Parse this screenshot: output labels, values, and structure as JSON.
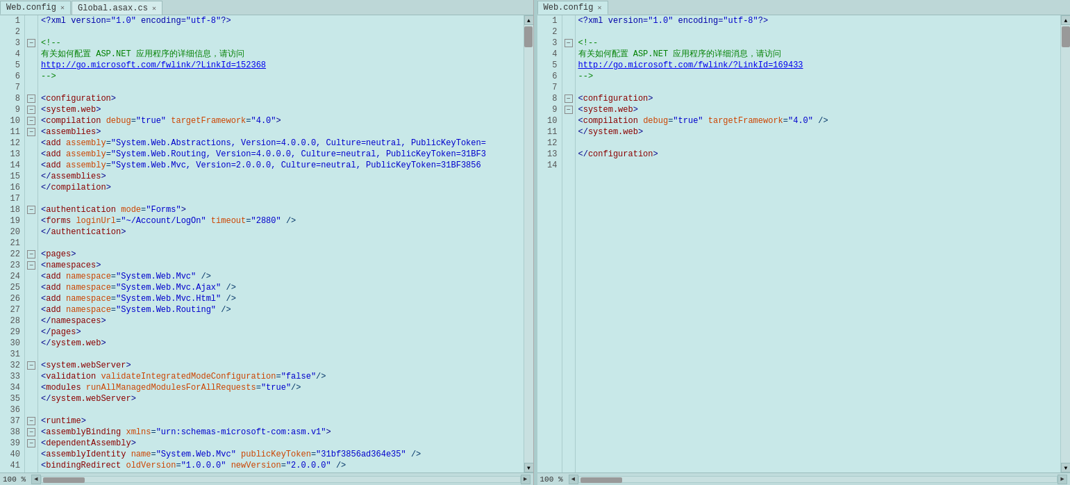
{
  "panes": [
    {
      "id": "left",
      "tabs": [
        {
          "label": "Web.config",
          "active": true,
          "closable": true
        },
        {
          "label": "Global.asax.cs",
          "active": false,
          "closable": true
        }
      ],
      "lines": [
        {
          "num": 1,
          "indent": 0,
          "collapse": null,
          "html": "<span class='xml-pi'>&lt;?xml version=<span class='xml-value'>\"1.0\"</span> encoding=<span class='xml-value'>\"utf-8\"</span>?&gt;</span>"
        },
        {
          "num": 2,
          "indent": 0,
          "collapse": null,
          "html": ""
        },
        {
          "num": 3,
          "indent": 0,
          "collapse": "minus",
          "html": "<span class='xml-comment'>&lt;!--</span>"
        },
        {
          "num": 4,
          "indent": 1,
          "collapse": null,
          "html": "<span class='xml-comment'>  有关如何配置 ASP.NET 应用程序的详细信息，请访问</span>"
        },
        {
          "num": 5,
          "indent": 1,
          "collapse": null,
          "html": "<span class='xml-link'>  http://go.microsoft.com/fwlink/?LinkId=152368</span>"
        },
        {
          "num": 6,
          "indent": 1,
          "collapse": null,
          "html": "<span class='xml-comment'>  --&gt;</span>"
        },
        {
          "num": 7,
          "indent": 0,
          "collapse": null,
          "html": ""
        },
        {
          "num": 8,
          "indent": 0,
          "collapse": "minus",
          "html": "<span class='xml-bracket'>&lt;</span><span class='xml-tag'>configuration</span><span class='xml-bracket'>&gt;</span>"
        },
        {
          "num": 9,
          "indent": 1,
          "collapse": "minus",
          "html": "  <span class='xml-bracket'>&lt;</span><span class='xml-tag'>system.web</span><span class='xml-bracket'>&gt;</span>"
        },
        {
          "num": 10,
          "indent": 2,
          "collapse": "minus",
          "html": "    <span class='xml-bracket'>&lt;</span><span class='xml-tag'>compilation</span> <span class='xml-attr'>debug</span>=<span class='xml-value'>\"true\"</span> <span class='xml-attr'>targetFramework</span>=<span class='xml-value'>\"4.0\"</span><span class='xml-bracket'>&gt;</span>"
        },
        {
          "num": 11,
          "indent": 3,
          "collapse": "minus",
          "html": "      <span class='xml-bracket'>&lt;</span><span class='xml-tag'>assemblies</span><span class='xml-bracket'>&gt;</span>"
        },
        {
          "num": 12,
          "indent": 4,
          "collapse": null,
          "html": "        <span class='xml-bracket'>&lt;</span><span class='xml-tag'>add</span> <span class='xml-attr'>assembly</span>=<span class='xml-value'>\"System.Web.Abstractions, Version=4.0.0.0, Culture=neutral, PublicKeyToken=</span>"
        },
        {
          "num": 13,
          "indent": 4,
          "collapse": null,
          "html": "        <span class='xml-bracket'>&lt;</span><span class='xml-tag'>add</span> <span class='xml-attr'>assembly</span>=<span class='xml-value'>\"System.Web.Routing, Version=4.0.0.0, Culture=neutral, PublicKeyToken=31BF3</span>"
        },
        {
          "num": 14,
          "indent": 4,
          "collapse": null,
          "html": "        <span class='xml-bracket'>&lt;</span><span class='xml-tag'>add</span> <span class='xml-attr'>assembly</span>=<span class='xml-value'>\"System.Web.Mvc, Version=2.0.0.0, Culture=neutral, PublicKeyToken=31BF3856</span>"
        },
        {
          "num": 15,
          "indent": 3,
          "collapse": null,
          "html": "      <span class='xml-bracket'>&lt;/</span><span class='xml-tag'>assemblies</span><span class='xml-bracket'>&gt;</span>"
        },
        {
          "num": 16,
          "indent": 2,
          "collapse": null,
          "html": "    <span class='xml-bracket'>&lt;/</span><span class='xml-tag'>compilation</span><span class='xml-bracket'>&gt;</span>"
        },
        {
          "num": 17,
          "indent": 0,
          "collapse": null,
          "html": ""
        },
        {
          "num": 18,
          "indent": 2,
          "collapse": "minus",
          "html": "    <span class='xml-bracket'>&lt;</span><span class='xml-tag'>authentication</span> <span class='xml-attr'>mode</span>=<span class='xml-value'>\"Forms\"</span><span class='xml-bracket'>&gt;</span>"
        },
        {
          "num": 19,
          "indent": 3,
          "collapse": null,
          "html": "      <span class='xml-bracket'>&lt;</span><span class='xml-tag'>forms</span> <span class='xml-attr'>loginUrl</span>=<span class='xml-value'>\"~/Account/LogOn\"</span> <span class='xml-attr'>timeout</span>=<span class='xml-value'>\"2880\"</span> /&gt;"
        },
        {
          "num": 20,
          "indent": 2,
          "collapse": null,
          "html": "    <span class='xml-bracket'>&lt;/</span><span class='xml-tag'>authentication</span><span class='xml-bracket'>&gt;</span>"
        },
        {
          "num": 21,
          "indent": 0,
          "collapse": null,
          "html": ""
        },
        {
          "num": 22,
          "indent": 2,
          "collapse": "minus",
          "html": "    <span class='xml-bracket'>&lt;</span><span class='xml-tag'>pages</span><span class='xml-bracket'>&gt;</span>"
        },
        {
          "num": 23,
          "indent": 3,
          "collapse": "minus",
          "html": "      <span class='xml-bracket'>&lt;</span><span class='xml-tag'>namespaces</span><span class='xml-bracket'>&gt;</span>"
        },
        {
          "num": 24,
          "indent": 4,
          "collapse": null,
          "html": "        <span class='xml-bracket'>&lt;</span><span class='xml-tag'>add</span> <span class='xml-attr'>namespace</span>=<span class='xml-value'>\"System.Web.Mvc\"</span> /&gt;"
        },
        {
          "num": 25,
          "indent": 4,
          "collapse": null,
          "html": "        <span class='xml-bracket'>&lt;</span><span class='xml-tag'>add</span> <span class='xml-attr'>namespace</span>=<span class='xml-value'>\"System.Web.Mvc.Ajax\"</span> /&gt;"
        },
        {
          "num": 26,
          "indent": 4,
          "collapse": null,
          "html": "        <span class='xml-bracket'>&lt;</span><span class='xml-tag'>add</span> <span class='xml-attr'>namespace</span>=<span class='xml-value'>\"System.Web.Mvc.Html\"</span> /&gt;"
        },
        {
          "num": 27,
          "indent": 4,
          "collapse": null,
          "html": "        <span class='xml-bracket'>&lt;</span><span class='xml-tag'>add</span> <span class='xml-attr'>namespace</span>=<span class='xml-value'>\"System.Web.Routing\"</span> /&gt;"
        },
        {
          "num": 28,
          "indent": 3,
          "collapse": null,
          "html": "      <span class='xml-bracket'>&lt;/</span><span class='xml-tag'>namespaces</span><span class='xml-bracket'>&gt;</span>"
        },
        {
          "num": 29,
          "indent": 2,
          "collapse": null,
          "html": "    <span class='xml-bracket'>&lt;/</span><span class='xml-tag'>pages</span><span class='xml-bracket'>&gt;</span>"
        },
        {
          "num": 30,
          "indent": 2,
          "collapse": null,
          "html": "    <span class='xml-bracket'>&lt;/</span><span class='xml-tag'>system.web</span><span class='xml-bracket'>&gt;</span>"
        },
        {
          "num": 31,
          "indent": 0,
          "collapse": null,
          "html": ""
        },
        {
          "num": 32,
          "indent": 1,
          "collapse": "minus",
          "html": "  <span class='xml-bracket'>&lt;</span><span class='xml-tag'>system.webServer</span><span class='xml-bracket'>&gt;</span>"
        },
        {
          "num": 33,
          "indent": 2,
          "collapse": null,
          "html": "    <span class='xml-bracket'>&lt;</span><span class='xml-tag'>validation</span> <span class='xml-attr'>validateIntegratedModeConfiguration</span>=<span class='xml-value'>\"false\"</span>/&gt;"
        },
        {
          "num": 34,
          "indent": 2,
          "collapse": null,
          "html": "    <span class='xml-bracket'>&lt;</span><span class='xml-tag'>modules</span> <span class='xml-attr'>runAllManagedModulesForAllRequests</span>=<span class='xml-value'>\"true\"</span>/&gt;"
        },
        {
          "num": 35,
          "indent": 1,
          "collapse": null,
          "html": "  <span class='xml-bracket'>&lt;/</span><span class='xml-tag'>system.webServer</span><span class='xml-bracket'>&gt;</span>"
        },
        {
          "num": 36,
          "indent": 0,
          "collapse": null,
          "html": ""
        },
        {
          "num": 37,
          "indent": 1,
          "collapse": "minus",
          "html": "  <span class='xml-bracket'>&lt;</span><span class='xml-tag'>runtime</span><span class='xml-bracket'>&gt;</span>"
        },
        {
          "num": 38,
          "indent": 2,
          "collapse": "minus",
          "html": "    <span class='xml-bracket'>&lt;</span><span class='xml-tag'>assemblyBinding</span> <span class='xml-attr'>xmlns</span>=<span class='xml-value'>\"urn:schemas-microsoft-com:asm.v1\"</span><span class='xml-bracket'>&gt;</span>"
        },
        {
          "num": 39,
          "indent": 3,
          "collapse": "minus",
          "html": "      <span class='xml-bracket'>&lt;</span><span class='xml-tag'>dependentAssembly</span><span class='xml-bracket'>&gt;</span>"
        },
        {
          "num": 40,
          "indent": 4,
          "collapse": null,
          "html": "        <span class='xml-bracket'>&lt;</span><span class='xml-tag'>assemblyIdentity</span> <span class='xml-attr'>name</span>=<span class='xml-value'>\"System.Web.Mvc\"</span> <span class='xml-attr'>publicKeyToken</span>=<span class='xml-value'>\"31bf3856ad364e35\"</span> /&gt;"
        },
        {
          "num": 41,
          "indent": 4,
          "collapse": null,
          "html": "        <span class='xml-bracket'>&lt;</span><span class='xml-tag'>bindingRedirect</span> <span class='xml-attr'>oldVersion</span>=<span class='xml-value'>\"1.0.0.0\"</span> <span class='xml-attr'>newVersion</span>=<span class='xml-value'>\"2.0.0.0\"</span> /&gt;"
        }
      ],
      "status": {
        "zoom": "100 %",
        "scroll_arrows": [
          "◄",
          "►"
        ]
      }
    },
    {
      "id": "right",
      "tabs": [
        {
          "label": "Web.config",
          "active": true,
          "closable": true
        }
      ],
      "lines": [
        {
          "num": 1,
          "indent": 0,
          "collapse": null,
          "html": "<span class='xml-pi'>&lt;?xml version=<span class='xml-value'>\"1.0\"</span> encoding=<span class='xml-value'>\"utf-8\"</span>?&gt;</span>"
        },
        {
          "num": 2,
          "indent": 0,
          "collapse": null,
          "html": ""
        },
        {
          "num": 3,
          "indent": 0,
          "collapse": "minus",
          "html": "<span class='xml-comment'>&lt;!--</span>"
        },
        {
          "num": 4,
          "indent": 1,
          "collapse": null,
          "html": "<span class='xml-comment'>  有关如何配置 ASP.NET 应用程序的详细消息，请访问</span>"
        },
        {
          "num": 5,
          "indent": 1,
          "collapse": null,
          "html": "<span class='xml-link'>  http://go.microsoft.com/fwlink/?LinkId=169433</span>"
        },
        {
          "num": 6,
          "indent": 1,
          "collapse": null,
          "html": "<span class='xml-comment'>  --&gt;</span>"
        },
        {
          "num": 7,
          "indent": 0,
          "collapse": null,
          "html": ""
        },
        {
          "num": 8,
          "indent": 0,
          "collapse": "minus",
          "html": "<span class='xml-bracket'>&lt;</span><span class='xml-tag'>configuration</span><span class='xml-bracket'>&gt;</span>"
        },
        {
          "num": 9,
          "indent": 1,
          "collapse": "minus",
          "html": "  <span class='xml-bracket'>&lt;</span><span class='xml-tag'>system.web</span><span class='xml-bracket'>&gt;</span>"
        },
        {
          "num": 10,
          "indent": 2,
          "collapse": null,
          "html": "    <span class='xml-bracket'>&lt;</span><span class='xml-tag'>compilation</span> <span class='xml-attr'>debug</span>=<span class='xml-value'>\"true\"</span> <span class='xml-attr'>targetFramework</span>=<span class='xml-value'>\"4.0\"</span> /&gt;"
        },
        {
          "num": 11,
          "indent": 2,
          "collapse": null,
          "html": "    <span class='xml-bracket'>&lt;/</span><span class='xml-tag'>system.web</span><span class='xml-bracket'>&gt;</span>"
        },
        {
          "num": 12,
          "indent": 0,
          "collapse": null,
          "html": ""
        },
        {
          "num": 13,
          "indent": 1,
          "collapse": null,
          "html": "  <span class='xml-bracket'>&lt;/</span><span class='xml-tag'>configuration</span><span class='xml-bracket'>&gt;</span>"
        },
        {
          "num": 14,
          "indent": 0,
          "collapse": null,
          "html": ""
        }
      ],
      "status": {
        "zoom": "100 %",
        "scroll_arrows": [
          "◄",
          "►"
        ]
      }
    }
  ]
}
